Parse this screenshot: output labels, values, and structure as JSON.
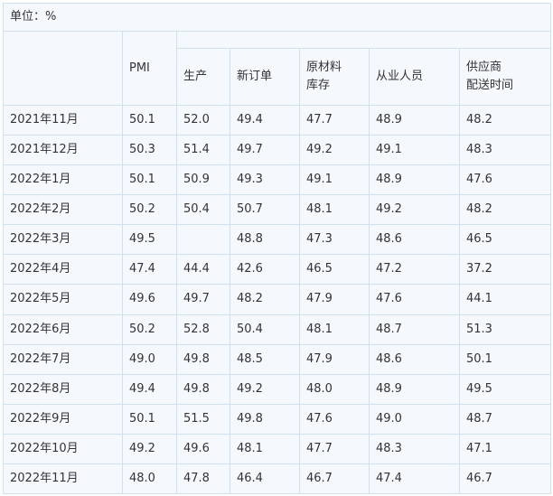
{
  "unit_label": "单位：%",
  "headers": [
    "PMI",
    "生产",
    "新订单",
    "原材料库存",
    "从业人员",
    "供应商配送时间"
  ],
  "header_lines": {
    "raw_material": [
      "原材料",
      "库存"
    ],
    "supplier": [
      "供应商",
      "配送时间"
    ]
  },
  "rows": [
    [
      "2021年11月",
      "50.1",
      "52.0",
      "49.4",
      "47.7",
      "48.9",
      "48.2"
    ],
    [
      "2021年12月",
      "50.3",
      "51.4",
      "49.7",
      "49.2",
      "49.1",
      "48.3"
    ],
    [
      "2022年1月",
      "50.1",
      "50.9",
      "49.3",
      "49.1",
      "48.9",
      "47.6"
    ],
    [
      "2022年2月",
      "50.2",
      "50.4",
      "50.7",
      "48.1",
      "49.2",
      "48.2"
    ],
    [
      "2022年3月",
      "49.5",
      "",
      "48.8",
      "47.3",
      "48.6",
      "46.5"
    ],
    [
      "2022年4月",
      "47.4",
      "44.4",
      "42.6",
      "46.5",
      "47.2",
      "37.2"
    ],
    [
      "2022年5月",
      "49.6",
      "49.7",
      "48.2",
      "47.9",
      "47.6",
      "44.1"
    ],
    [
      "2022年6月",
      "50.2",
      "52.8",
      "50.4",
      "48.1",
      "48.7",
      "51.3"
    ],
    [
      "2022年7月",
      "49.0",
      "49.8",
      "48.5",
      "47.9",
      "48.6",
      "50.1"
    ],
    [
      "2022年8月",
      "49.4",
      "49.8",
      "49.2",
      "48.0",
      "48.9",
      "49.5"
    ],
    [
      "2022年9月",
      "50.1",
      "51.5",
      "49.8",
      "47.6",
      "49.0",
      "48.7"
    ],
    [
      "2022年10月",
      "49.2",
      "49.6",
      "48.1",
      "47.7",
      "48.3",
      "47.1"
    ],
    [
      "2022年11月",
      "48.0",
      "47.8",
      "46.4",
      "46.7",
      "47.4",
      "46.7"
    ]
  ]
}
